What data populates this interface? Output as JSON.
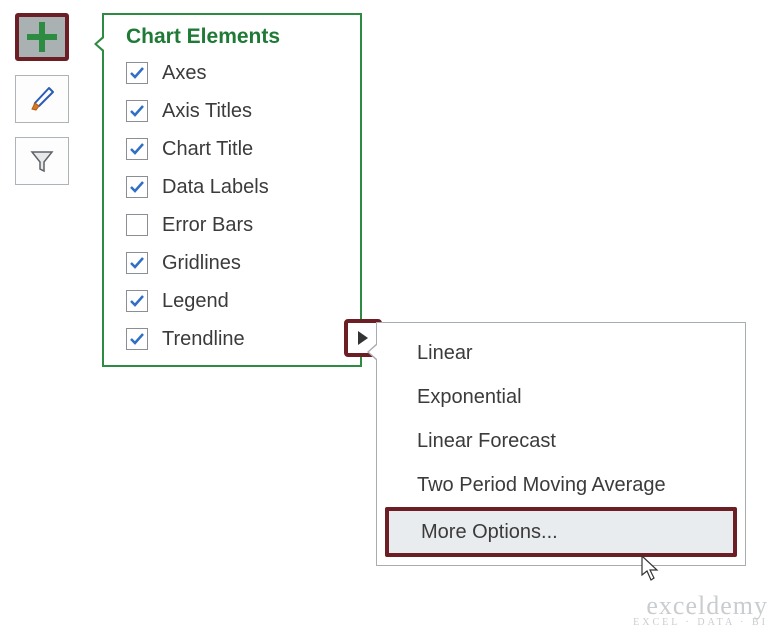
{
  "toolbar": {
    "buttons": [
      {
        "name": "chart-elements-button",
        "icon": "plus-icon",
        "selected": true
      },
      {
        "name": "chart-styles-button",
        "icon": "brush-icon",
        "selected": false
      },
      {
        "name": "chart-filters-button",
        "icon": "funnel-icon",
        "selected": false
      }
    ]
  },
  "chart_elements": {
    "title": "Chart Elements",
    "items": [
      {
        "label": "Axes",
        "checked": true
      },
      {
        "label": "Axis Titles",
        "checked": true
      },
      {
        "label": "Chart Title",
        "checked": true
      },
      {
        "label": "Data Labels",
        "checked": true
      },
      {
        "label": "Error Bars",
        "checked": false
      },
      {
        "label": "Gridlines",
        "checked": true
      },
      {
        "label": "Legend",
        "checked": true
      },
      {
        "label": "Trendline",
        "checked": true,
        "expanded": true
      }
    ]
  },
  "trendline_submenu": {
    "items": [
      {
        "label": "Linear",
        "hover": false
      },
      {
        "label": "Exponential",
        "hover": false
      },
      {
        "label": "Linear Forecast",
        "hover": false
      },
      {
        "label": "Two Period Moving Average",
        "hover": false
      },
      {
        "label": "More Options...",
        "hover": true
      }
    ]
  },
  "watermark": {
    "big": "exceldemy",
    "small": "EXCEL · DATA · BI"
  }
}
